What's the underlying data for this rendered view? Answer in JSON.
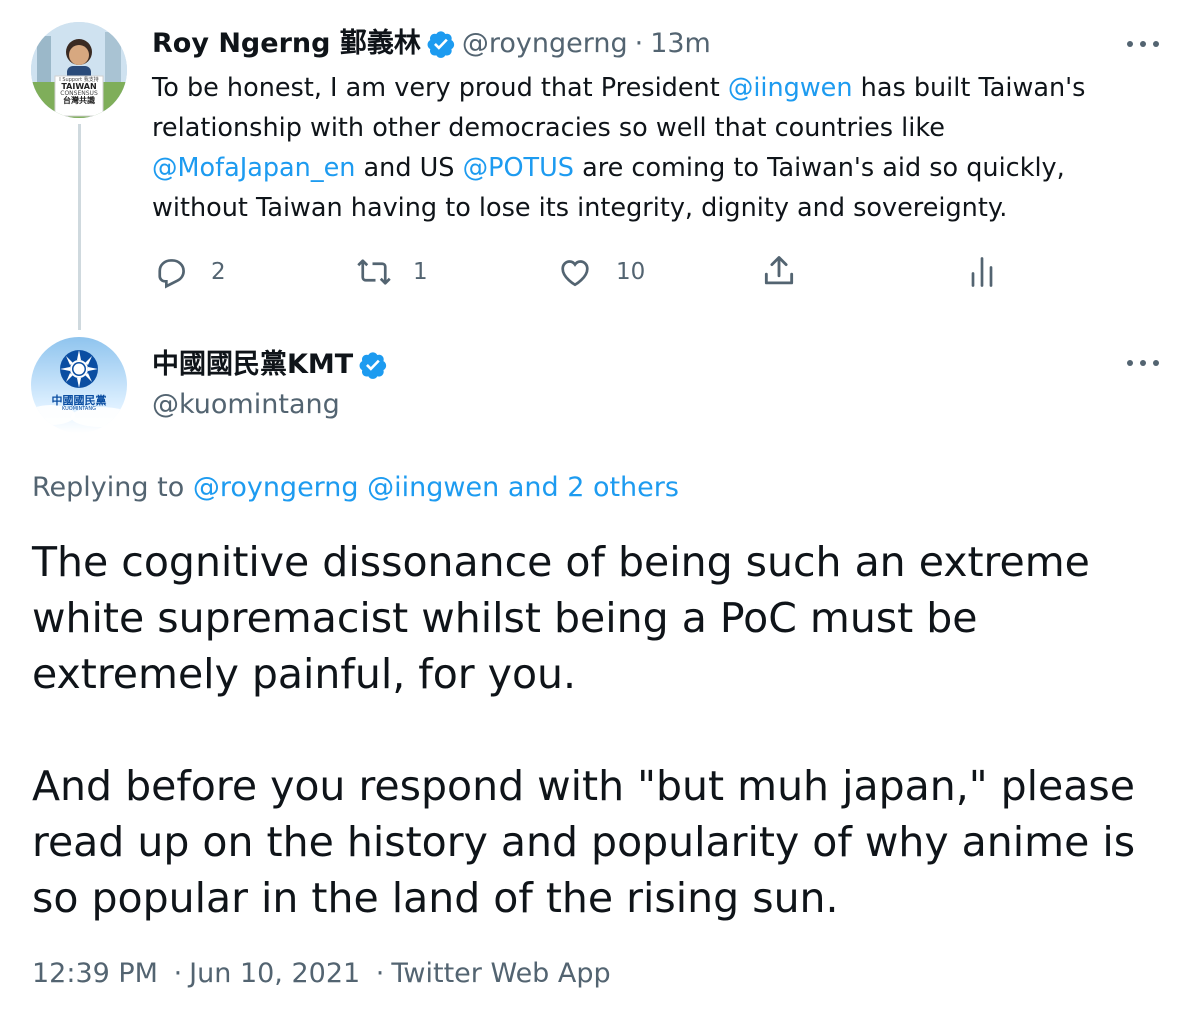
{
  "parent_tweet": {
    "avatar_text": [
      "I Support 我支持",
      "TAIWAN",
      "CONSENSUS",
      "台灣共識"
    ],
    "display_name": "Roy Ngerng 鄞義林",
    "handle": "@royngerng",
    "separator": "·",
    "time_ago": "13m",
    "text": {
      "line1_a": "To be honest, I am very proud that President ",
      "line1_mention": "@iingwen",
      "line1_b": " has built Taiwan's",
      "line2": "relationship with other democracies so well that countries like",
      "line3_mention1": "@MofaJapan_en",
      "line3_a": " and US ",
      "line3_mention2": "@POTUS",
      "line3_b": " are coming to Taiwan's aid so quickly,",
      "line4": "without Taiwan having to lose its integrity, dignity and sovereignty."
    },
    "actions": {
      "reply_count": "2",
      "retweet_count": "1",
      "like_count": "10"
    },
    "icons": [
      "reply-icon",
      "retweet-icon",
      "like-icon",
      "share-icon",
      "analytics-icon",
      "more-icon",
      "verified-badge-icon"
    ]
  },
  "reply_tweet": {
    "avatar_text": [
      "中國國民黨",
      "KUOMINTANG"
    ],
    "display_name": "中國國民黨KMT",
    "handle": "@kuomintang",
    "replying_prefix": "Replying to ",
    "replying_mention1": "@royngerng",
    "replying_mention2": "@iingwen",
    "replying_others": "and 2 others",
    "body": {
      "para1_line1": "The cognitive dissonance of being such an extreme",
      "para1_line2": "white supremacist whilst being a PoC must be",
      "para1_line3": "extremely painful, for you.",
      "para2_line1": "And before you respond with \"but muh japan,\" please",
      "para2_line2": "read up on the history and popularity of why anime is",
      "para2_line3": "so popular in the land of the rising sun."
    },
    "time": "12:39 PM",
    "separator": "·",
    "date": "Jun 10, 2021",
    "source": "Twitter Web App"
  },
  "colors": {
    "accent": "#1d9bf0",
    "text": "#0f1419",
    "muted": "#536471",
    "thread_line": "#cfd9de"
  }
}
